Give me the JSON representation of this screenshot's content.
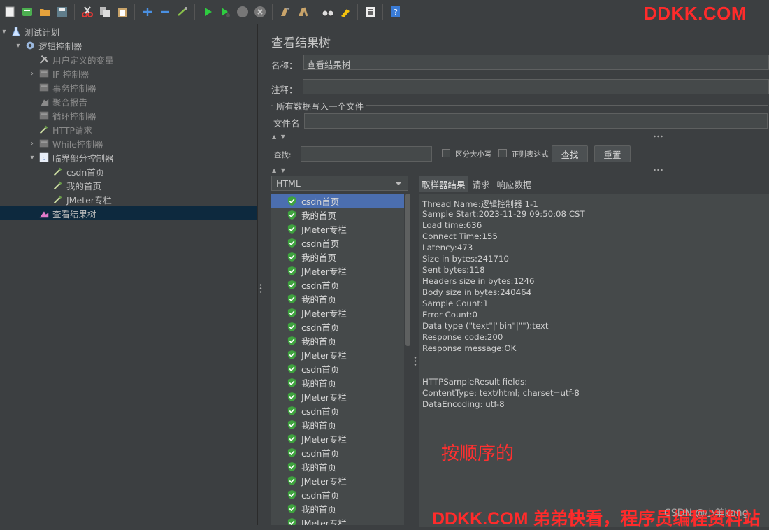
{
  "toolbar": {
    "icons": [
      "new-icon",
      "templates-icon",
      "open-icon",
      "save-icon",
      "cut-icon",
      "copy-icon",
      "paste-icon",
      "expand-icon",
      "collapse-icon",
      "toggle-icon",
      "start-icon",
      "start-no-pause-icon",
      "stop-icon",
      "shutdown-icon",
      "clear-icon",
      "clear-all-icon",
      "search-icon",
      "reset-search-icon",
      "function-helper-icon",
      "help-icon"
    ]
  },
  "watermark_top": "DDKK.COM",
  "tree": {
    "items": [
      {
        "label": "测试计划",
        "icon": "test-plan-icon",
        "level": 0,
        "arrow": "▾"
      },
      {
        "label": "逻辑控制器",
        "icon": "gear-icon",
        "level": 1,
        "arrow": "▾"
      },
      {
        "label": "用户定义的变量",
        "icon": "wrench-icon",
        "level": 2,
        "arrow": "",
        "disabled": true
      },
      {
        "label": "IF 控制器",
        "icon": "controller-icon",
        "level": 2,
        "arrow": "›",
        "disabled": true
      },
      {
        "label": "事务控制器",
        "icon": "controller-icon",
        "level": 2,
        "arrow": "",
        "disabled": true
      },
      {
        "label": "聚合报告",
        "icon": "chart-icon",
        "level": 2,
        "arrow": "",
        "disabled": true
      },
      {
        "label": "循环控制器",
        "icon": "controller-icon",
        "level": 2,
        "arrow": "",
        "disabled": true
      },
      {
        "label": "HTTP请求",
        "icon": "pipette-icon",
        "level": 2,
        "arrow": "",
        "disabled": true
      },
      {
        "label": "While控制器",
        "icon": "controller-icon",
        "level": 2,
        "arrow": "›",
        "disabled": true
      },
      {
        "label": "临界部分控制器",
        "icon": "critical-icon",
        "level": 2,
        "arrow": "▾"
      },
      {
        "label": "csdn首页",
        "icon": "pipette-icon",
        "level": 3,
        "arrow": ""
      },
      {
        "label": "我的首页",
        "icon": "pipette-icon",
        "level": 3,
        "arrow": ""
      },
      {
        "label": "JMeter专栏",
        "icon": "pipette-icon",
        "level": 3,
        "arrow": ""
      },
      {
        "label": "查看结果树",
        "icon": "listener-icon",
        "level": 2,
        "arrow": "",
        "selected": true
      }
    ]
  },
  "panel": {
    "title": "查看结果树",
    "name_label": "名称：",
    "name_value": "查看结果树",
    "comment_label": "注释：",
    "comment_value": "",
    "fieldset_legend": "所有数据写入一个文件",
    "filename_label": "文件名",
    "filename_value": "",
    "search_label": "查找:",
    "search_value": "",
    "case_label": "区分大小写",
    "regex_label": "正则表达式",
    "find_button": "查找",
    "reset_button": "重置"
  },
  "renderer": {
    "selected": "HTML"
  },
  "results": [
    "csdn首页",
    "我的首页",
    "JMeter专栏",
    "csdn首页",
    "我的首页",
    "JMeter专栏",
    "csdn首页",
    "我的首页",
    "JMeter专栏",
    "csdn首页",
    "我的首页",
    "JMeter专栏",
    "csdn首页",
    "我的首页",
    "JMeter专栏",
    "csdn首页",
    "我的首页",
    "JMeter专栏",
    "csdn首页",
    "我的首页",
    "JMeter专栏",
    "csdn首页",
    "我的首页",
    "JMeter专栏"
  ],
  "tabs": [
    "取样器结果",
    "请求",
    "响应数据"
  ],
  "sampler_result": [
    "Thread Name:逻辑控制器 1-1",
    "Sample Start:2023-11-29 09:50:08 CST",
    "Load time:636",
    "Connect Time:155",
    "Latency:473",
    "Size in bytes:241710",
    "Sent bytes:118",
    "Headers size in bytes:1246",
    "Body size in bytes:240464",
    "Sample Count:1",
    "Error Count:0",
    "Data type (\"text\"|\"bin\"|\"\"):text",
    "Response code:200",
    "Response message:OK",
    "",
    "",
    "HTTPSampleResult fields:",
    "ContentType: text/html; charset=utf-8",
    "DataEncoding: utf-8"
  ],
  "annotation": "按顺序的",
  "watermark_bottom": "DDKK.COM 弟弟快看，程序员编程资料站",
  "credit": "CSDN @小羊kang",
  "colors": {
    "bg": "#3c3f41",
    "field": "#45494a",
    "selection": "#4b6eaf",
    "tree_selection": "#0d293e",
    "ok_green": "#3fa33f",
    "watermark": "#ff2b2b"
  }
}
